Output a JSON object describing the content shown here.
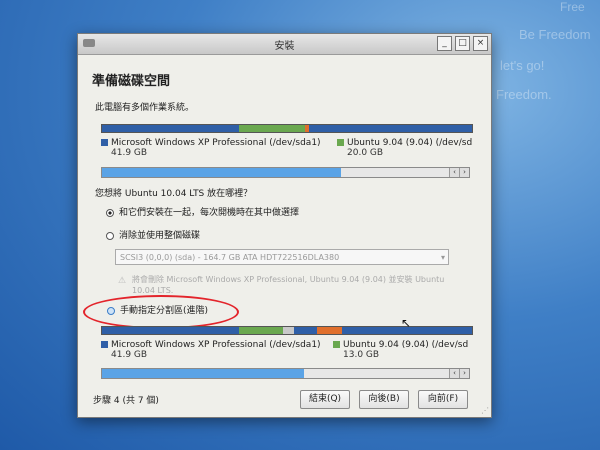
{
  "background": {
    "texts": [
      "Free",
      "Be Freedom",
      "let's go!",
      "Freedom."
    ]
  },
  "window": {
    "title": "安裝",
    "buttons": [
      "_",
      "□",
      "×"
    ]
  },
  "page": {
    "heading": "準備磁碟空間",
    "subtitle": "此電腦有多個作業系統。",
    "question": "您想將 Ubuntu 10.04 LTS 放在哪裡？",
    "step": "步驟 4 (共 7 個)"
  },
  "colors": {
    "blue": "#2f5fa7",
    "green": "#6aa84f",
    "orange": "#e06f2c",
    "selection": "#5aa3e6",
    "highlight_circle": "#e3242b"
  },
  "current_disk": {
    "partitions": [
      {
        "name": "Microsoft Windows XP Professional (/dev/sda1)",
        "size": "41.9 GB",
        "color": "#2f5fa7"
      },
      {
        "name": "Ubuntu 9.04 (9.04) (/dev/sd",
        "size": "20.0 GB",
        "color": "#6aa84f"
      }
    ],
    "scroll_fraction": 0.65
  },
  "options": [
    {
      "label": "和它們安裝在一起，每次開機時在其中做選擇",
      "selected": true
    },
    {
      "label": "消除並使用整個磁碟",
      "selected": false
    },
    {
      "label": "手動指定分割區(進階)",
      "selected": false
    }
  ],
  "erase_disk": {
    "select_value": "SCSI3 (0,0,0) (sda) - 164.7 GB ATA HDT722516DLA380",
    "warning": "將會刪除 Microsoft Windows XP Professional, Ubuntu 9.04 (9.04) 並安裝 Ubuntu 10.04 LTS."
  },
  "new_disk": {
    "partitions": [
      {
        "name": "Microsoft Windows XP Professional (/dev/sda1)",
        "size": "41.9 GB",
        "color": "#2f5fa7"
      },
      {
        "name": "Ubuntu 9.04 (9.04) (/dev/sd",
        "size": "13.0 GB",
        "color": "#6aa84f"
      }
    ],
    "scroll_fraction": 0.55
  },
  "footer": {
    "quit": "結束(Q)",
    "back": "向後(B)",
    "forward": "向前(F)"
  }
}
